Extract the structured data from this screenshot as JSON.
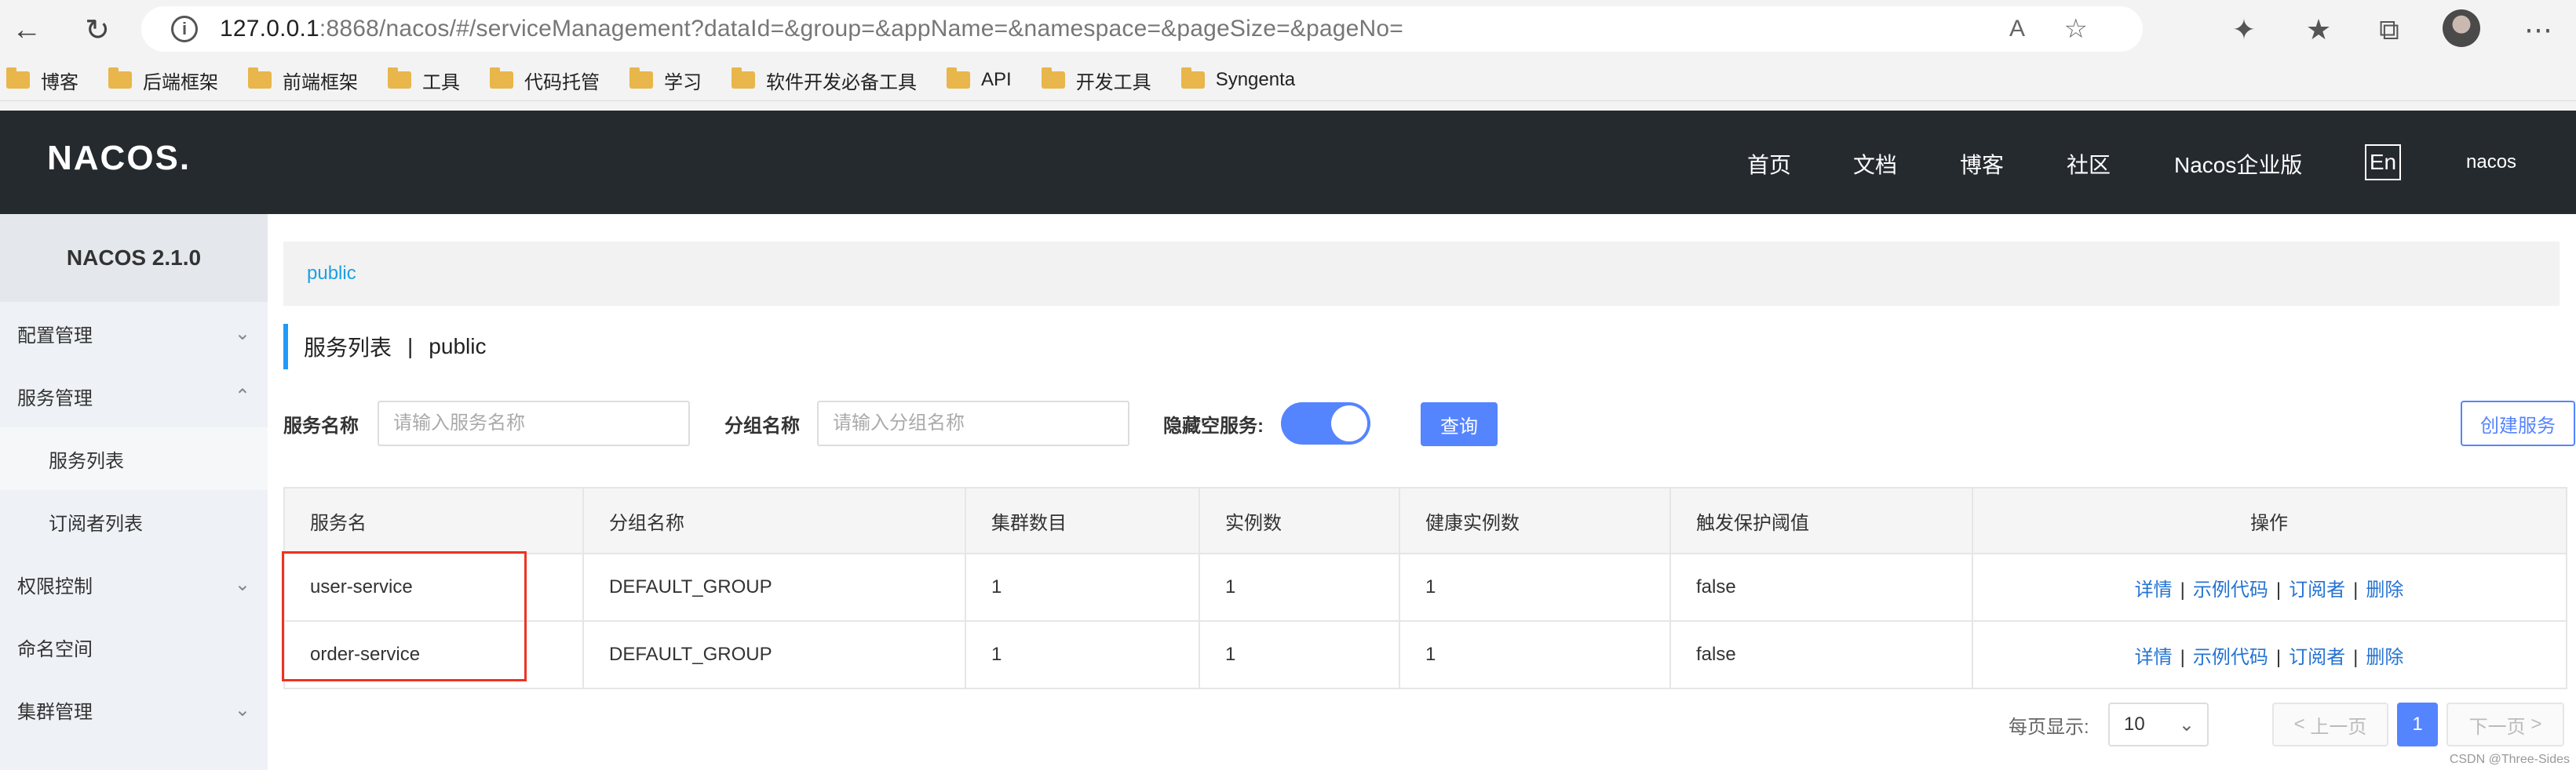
{
  "browser": {
    "url_host": "127.0.0.1",
    "url_rest": ":8868/nacos/#/serviceManagement?dataId=&group=&appName=&namespace=&pageSize=&pageNo=",
    "reader_label": "A",
    "bookmarks": [
      "博客",
      "后端框架",
      "前端框架",
      "工具",
      "代码托管",
      "学习",
      "软件开发必备工具",
      "API",
      "开发工具",
      "Syngenta"
    ]
  },
  "header": {
    "logo": "NACOS.",
    "nav": [
      "首页",
      "文档",
      "博客",
      "社区",
      "Nacos企业版"
    ],
    "lang": "En",
    "user": "nacos"
  },
  "sidebar": {
    "title": "NACOS 2.1.0",
    "items": [
      {
        "label": "配置管理",
        "chevron": "⌄"
      },
      {
        "label": "服务管理",
        "chevron": "⌃"
      },
      {
        "label": "服务列表"
      },
      {
        "label": "订阅者列表"
      },
      {
        "label": "权限控制",
        "chevron": "⌄"
      },
      {
        "label": "命名空间"
      },
      {
        "label": "集群管理",
        "chevron": "⌄"
      }
    ]
  },
  "main": {
    "namespace_tab": "public",
    "title": "服务列表",
    "title_sep": "|",
    "title_ns": "public",
    "filter": {
      "service_label": "服务名称",
      "service_placeholder": "请输入服务名称",
      "group_label": "分组名称",
      "group_placeholder": "请输入分组名称",
      "hide_empty_label": "隐藏空服务:",
      "hide_empty_on": true,
      "query_button": "查询",
      "create_button": "创建服务"
    },
    "table": {
      "headers": [
        "服务名",
        "分组名称",
        "集群数目",
        "实例数",
        "健康实例数",
        "触发保护阈值",
        "操作"
      ],
      "rows": [
        {
          "name": "user-service",
          "group": "DEFAULT_GROUP",
          "clusters": "1",
          "instances": "1",
          "healthy": "1",
          "threshold": "false"
        },
        {
          "name": "order-service",
          "group": "DEFAULT_GROUP",
          "clusters": "1",
          "instances": "1",
          "healthy": "1",
          "threshold": "false"
        }
      ],
      "ops": [
        "详情",
        "示例代码",
        "订阅者",
        "删除"
      ],
      "op_sep": "|"
    },
    "pager": {
      "page_size_label": "每页显示:",
      "page_size": "10",
      "prev": "上一页",
      "prev_icon": "<",
      "current": "1",
      "next": "下一页",
      "next_icon": ">"
    }
  },
  "watermark": "CSDN @Three-Sides",
  "colors": {
    "primary": "#5584ff",
    "header_bg": "#252a2f",
    "link": "#2473d3",
    "highlight": "#ee3322"
  }
}
